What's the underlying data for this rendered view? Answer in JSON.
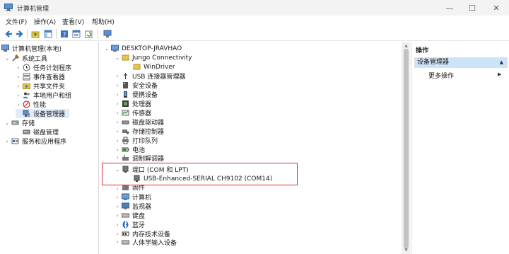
{
  "window": {
    "title": "计算机管理"
  },
  "menu": [
    "文件(F)",
    "操作(A)",
    "查看(V)",
    "帮助(H)"
  ],
  "left_tree": {
    "root": "计算机管理(本地)",
    "system_tools": "系统工具",
    "task_scheduler": "任务计划程序",
    "event_viewer": "事件查看器",
    "shared_folders": "共享文件夹",
    "local_users": "本地用户和组",
    "performance": "性能",
    "device_manager": "设备管理器",
    "storage": "存储",
    "disk_management": "磁盘管理",
    "services": "服务和应用程序"
  },
  "device_tree": {
    "computer": "DESKTOP-JRAVHAO",
    "jungo": "Jungo Connectivity",
    "windriver": "WinDriver",
    "items_before": [
      "USB 连接器管理器",
      "安全设备",
      "便携设备",
      "处理器",
      "传感器",
      "磁盘驱动器",
      "存储控制器",
      "打印队列",
      "电池",
      "调制解调器"
    ],
    "ports": "端口 (COM 和 LPT)",
    "usb_serial": "USB-Enhanced-SERIAL CH9102 (COM14)",
    "items_after": [
      "固件",
      "计算机",
      "监视器",
      "键盘",
      "蓝牙",
      "内存技术设备",
      "人体学输入设备"
    ]
  },
  "actions": {
    "header": "操作",
    "selected": "设备管理器",
    "more": "更多操作"
  }
}
